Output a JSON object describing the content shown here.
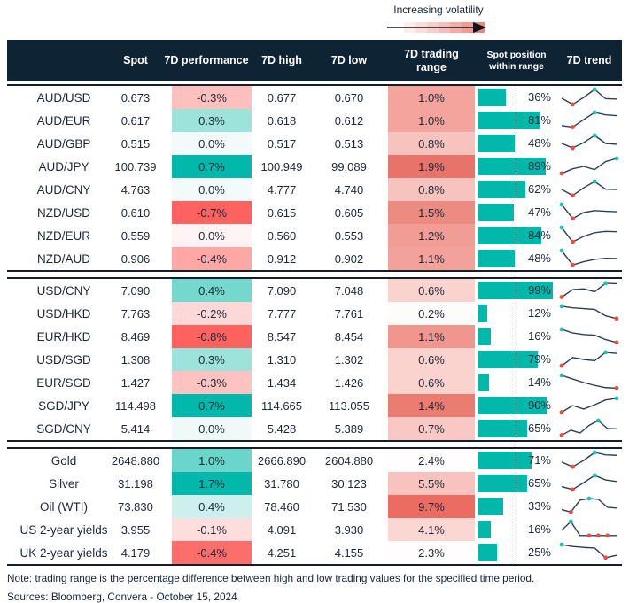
{
  "legend": {
    "label": "Increasing volatility",
    "gradient_stops": [
      "#ffffff",
      "#fdeeed",
      "#fcdedc",
      "#facecb",
      "#f8bdb9",
      "#f7aba6",
      "#f59992",
      "#f4837c"
    ]
  },
  "chart_data": {
    "type": "table",
    "columns": [
      {
        "key": "name",
        "label": ""
      },
      {
        "key": "spot",
        "label": "Spot"
      },
      {
        "key": "perf",
        "label": "7D performance"
      },
      {
        "key": "high",
        "label": "7D high"
      },
      {
        "key": "low",
        "label": "7D low"
      },
      {
        "key": "range",
        "label": "7D trading range"
      },
      {
        "key": "pos",
        "label": "Spot position within range"
      },
      {
        "key": "trend",
        "label": "7D trend"
      }
    ],
    "groups": [
      {
        "rows": [
          {
            "name": "AUD/USD",
            "spot": "0.673",
            "perf": "-0.3%",
            "perf_bg": "#fec0bd",
            "high": "0.677",
            "low": "0.670",
            "range": "1.0%",
            "range_bg": "#f3a49d",
            "pos": "36%",
            "pos_pct": 36,
            "spark": {
              "v": [
                0.45,
                0.06,
                0.5,
                1.0,
                0.42,
                0.4
              ],
              "min": [
                1
              ],
              "max": [
                3
              ]
            }
          },
          {
            "name": "AUD/EUR",
            "spot": "0.617",
            "perf": "0.3%",
            "perf_bg": "#9de3db",
            "high": "0.618",
            "low": "0.612",
            "range": "1.0%",
            "range_bg": "#f3a49d",
            "pos": "81%",
            "pos_pct": 81,
            "spark": {
              "v": [
                0.18,
                0.08,
                0.55,
                1.0,
                0.85,
                0.8
              ],
              "min": [
                1
              ],
              "max": [
                3
              ]
            }
          },
          {
            "name": "AUD/GBP",
            "spot": "0.515",
            "perf": "0.0%",
            "perf_bg": "#f3fafa",
            "high": "0.517",
            "low": "0.513",
            "range": "0.8%",
            "range_bg": "#f7c3be",
            "pos": "48%",
            "pos_pct": 48,
            "spark": {
              "v": [
                0.5,
                0.22,
                0.55,
                1.0,
                0.5,
                0.45
              ],
              "min": [
                1
              ],
              "max": [
                3
              ]
            }
          },
          {
            "name": "AUD/JPY",
            "spot": "100.739",
            "perf": "0.7%",
            "perf_bg": "#01b8aa",
            "high": "100.949",
            "low": "99.089",
            "range": "1.9%",
            "range_bg": "#e6746a",
            "pos": "89%",
            "pos_pct": 89,
            "spark": {
              "v": [
                0.06,
                0.35,
                0.5,
                0.3,
                0.8,
                1.0
              ],
              "min": [
                0
              ],
              "max": [
                5
              ]
            }
          },
          {
            "name": "AUD/CNY",
            "spot": "4.763",
            "perf": "0.0%",
            "perf_bg": "#f3fafa",
            "high": "4.777",
            "low": "4.740",
            "range": "0.8%",
            "range_bg": "#f7c3be",
            "pos": "62%",
            "pos_pct": 62,
            "spark": {
              "v": [
                0.5,
                0.12,
                0.6,
                1.0,
                0.52,
                0.5
              ],
              "min": [
                1
              ],
              "max": [
                3
              ]
            }
          },
          {
            "name": "NZD/USD",
            "spot": "0.610",
            "perf": "-0.7%",
            "perf_bg": "#fd625e",
            "high": "0.615",
            "low": "0.605",
            "range": "1.5%",
            "range_bg": "#ec8b82",
            "pos": "47%",
            "pos_pct": 47,
            "spark": {
              "v": [
                1.0,
                0.12,
                0.5,
                0.62,
                0.58,
                0.55
              ],
              "min": [
                1
              ],
              "max": [
                0
              ]
            }
          },
          {
            "name": "NZD/EUR",
            "spot": "0.559",
            "perf": "0.0%",
            "perf_bg": "#fdf4f3",
            "high": "0.560",
            "low": "0.553",
            "range": "1.2%",
            "range_bg": "#f19d96",
            "pos": "84%",
            "pos_pct": 84,
            "spark": {
              "v": [
                1.0,
                0.1,
                0.45,
                0.68,
                0.76,
                0.74
              ],
              "min": [
                1
              ],
              "max": [
                0
              ]
            }
          },
          {
            "name": "NZD/AUD",
            "spot": "0.906",
            "perf": "-0.4%",
            "perf_bg": "#fea8a5",
            "high": "0.912",
            "low": "0.902",
            "range": "1.1%",
            "range_bg": "#f2a19b",
            "pos": "48%",
            "pos_pct": 48,
            "spark": {
              "v": [
                1.0,
                0.1,
                0.3,
                0.45,
                0.52,
                0.5
              ],
              "min": [
                1
              ],
              "max": [
                0
              ]
            }
          }
        ]
      },
      {
        "rows": [
          {
            "name": "USD/CNY",
            "spot": "7.090",
            "perf": "0.4%",
            "perf_bg": "#75d8cf",
            "high": "7.090",
            "low": "7.048",
            "range": "0.6%",
            "range_bg": "#fad2ce",
            "pos": "99%",
            "pos_pct": 99,
            "spark": {
              "v": [
                0.08,
                0.55,
                0.6,
                0.42,
                0.95,
                0.92
              ],
              "min": [
                0
              ],
              "max": [
                4
              ]
            }
          },
          {
            "name": "USD/HKD",
            "spot": "7.763",
            "perf": "-0.2%",
            "perf_bg": "#fed8d7",
            "high": "7.777",
            "low": "7.761",
            "range": "0.2%",
            "range_bg": "#fefbfb",
            "pos": "12%",
            "pos_pct": 12,
            "spark": {
              "v": [
                0.95,
                0.85,
                0.8,
                0.75,
                0.35,
                0.18
              ],
              "min": [
                5
              ],
              "max": [
                0
              ]
            }
          },
          {
            "name": "EUR/HKD",
            "spot": "8.469",
            "perf": "-0.8%",
            "perf_bg": "#fd625e",
            "high": "8.547",
            "low": "8.454",
            "range": "1.1%",
            "range_bg": "#f0968e",
            "pos": "16%",
            "pos_pct": 16,
            "spark": {
              "v": [
                0.95,
                0.72,
                0.62,
                0.58,
                0.3,
                0.12
              ],
              "min": [
                5
              ],
              "max": [
                0
              ]
            }
          },
          {
            "name": "USD/SGD",
            "spot": "1.308",
            "perf": "0.3%",
            "perf_bg": "#9de3db",
            "high": "1.310",
            "low": "1.302",
            "range": "0.6%",
            "range_bg": "#fad2ce",
            "pos": "79%",
            "pos_pct": 79,
            "spark": {
              "v": [
                0.1,
                0.62,
                0.5,
                0.42,
                0.95,
                0.88
              ],
              "min": [
                0
              ],
              "max": [
                4
              ]
            }
          },
          {
            "name": "EUR/SGD",
            "spot": "1.427",
            "perf": "-0.3%",
            "perf_bg": "#fec2c0",
            "high": "1.434",
            "low": "1.426",
            "range": "0.6%",
            "range_bg": "#fad2ce",
            "pos": "14%",
            "pos_pct": 14,
            "spark": {
              "v": [
                0.95,
                0.72,
                0.5,
                0.32,
                0.18,
                0.15
              ],
              "min": [
                5
              ],
              "max": [
                0
              ]
            }
          },
          {
            "name": "SGD/JPY",
            "spot": "114.498",
            "perf": "0.7%",
            "perf_bg": "#01b8aa",
            "high": "114.665",
            "low": "113.055",
            "range": "1.4%",
            "range_bg": "#ea7c72",
            "pos": "90%",
            "pos_pct": 90,
            "spark": {
              "v": [
                0.08,
                0.5,
                0.28,
                0.55,
                0.85,
                0.95
              ],
              "min": [
                0
              ],
              "max": [
                5
              ]
            }
          },
          {
            "name": "SGD/CNY",
            "spot": "5.414",
            "perf": "0.0%",
            "perf_bg": "#effaf8",
            "high": "5.428",
            "low": "5.389",
            "range": "0.7%",
            "range_bg": "#f9c8c4",
            "pos": "65%",
            "pos_pct": 65,
            "spark": {
              "v": [
                0.08,
                0.4,
                0.22,
                0.7,
                1.0,
                0.5,
                0.48
              ],
              "min": [
                0
              ],
              "max": [
                4
              ]
            }
          }
        ]
      },
      {
        "rows": [
          {
            "name": "Gold",
            "spot": "2648.880",
            "perf": "1.0%",
            "perf_bg": "#69d5cb",
            "high": "2666.890",
            "low": "2604.880",
            "range": "2.4%",
            "range_bg": "#fffdfd",
            "pos": "71%",
            "pos_pct": 71,
            "spark": {
              "v": [
                0.4,
                0.1,
                0.5,
                1.0,
                0.85,
                0.82
              ],
              "min": [
                1
              ],
              "max": [
                3
              ]
            }
          },
          {
            "name": "Silver",
            "spot": "31.198",
            "perf": "1.7%",
            "perf_bg": "#01b8aa",
            "high": "31.780",
            "low": "30.123",
            "range": "5.5%",
            "range_bg": "#f8c3bf",
            "pos": "65%",
            "pos_pct": 65,
            "spark": {
              "v": [
                0.3,
                0.12,
                0.55,
                1.0,
                0.72,
                0.62
              ],
              "min": [
                1
              ],
              "max": [
                3
              ]
            }
          },
          {
            "name": "Oil (WTI)",
            "spot": "73.830",
            "perf": "0.4%",
            "perf_bg": "#cdf0ec",
            "high": "78.460",
            "low": "71.530",
            "range": "9.7%",
            "range_bg": "#ec6c62",
            "pos": "33%",
            "pos_pct": 33,
            "spark": {
              "v": [
                0.3,
                0.15,
                0.9,
                1.0,
                0.95,
                0.45,
                0.4
              ],
              "min": [
                1
              ],
              "max": [
                3
              ]
            }
          },
          {
            "name": "US 2-year yields",
            "spot": "3.955",
            "perf": "-0.1%",
            "perf_bg": "#fededd",
            "high": "4.091",
            "low": "3.930",
            "range": "4.1%",
            "range_bg": "#fbd7d4",
            "pos": "16%",
            "pos_pct": 16,
            "spark": {
              "v": [
                0.45,
                1.0,
                0.12,
                0.12,
                0.12,
                0.12,
                0.12
              ],
              "min": [
                3,
                4,
                5
              ],
              "max": [
                1
              ]
            }
          },
          {
            "name": "UK 2-year yields",
            "spot": "4.179",
            "perf": "-0.4%",
            "perf_bg": "#fc6e6a",
            "high": "4.251",
            "low": "4.155",
            "range": "2.3%",
            "range_bg": "#fffdfd",
            "pos": "25%",
            "pos_pct": 25,
            "spark": {
              "v": [
                1.0,
                0.88,
                0.82,
                0.78,
                0.18,
                0.32
              ],
              "min": [
                4
              ],
              "max": [
                0
              ]
            }
          }
        ]
      }
    ]
  },
  "footer": {
    "note": "Note: trading range is the percentage difference between high and low trading values for the specified time period.",
    "sources": "Sources: Bloomberg, Convera - October 15, 2024"
  },
  "colors": {
    "header_bg": "#0e2334",
    "teal": "#01b8aa",
    "red": "#fd625e",
    "bar": "#01b8aa",
    "spark_line": "#2e3f54",
    "spark_min_dot": "#e74c45",
    "spark_max_dot": "#22c1b2",
    "text": "#1c2838"
  }
}
